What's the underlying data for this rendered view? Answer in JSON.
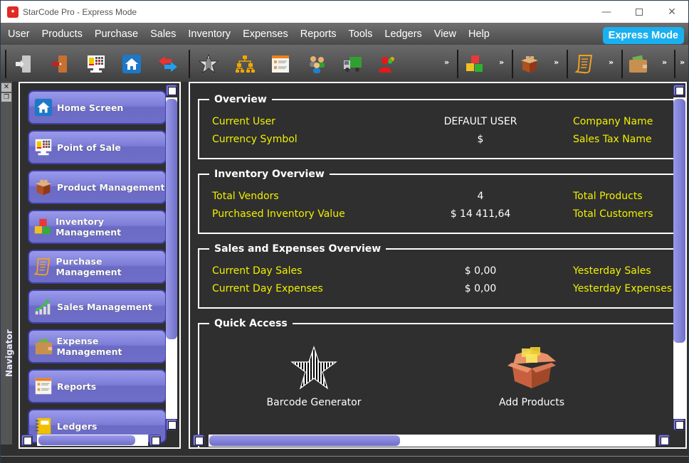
{
  "window": {
    "title": "StarCode Pro - Express Mode",
    "app_icon": "starcode-logo-icon",
    "controls": [
      "minimize",
      "maximize",
      "close"
    ]
  },
  "menubar": {
    "items": [
      "User",
      "Products",
      "Purchase",
      "Sales",
      "Inventory",
      "Expenses",
      "Reports",
      "Tools",
      "Ledgers",
      "View",
      "Help"
    ],
    "mode_badge": "Express Mode",
    "mode_badge_color": "#1ab0f0"
  },
  "toolbar": {
    "groups": [
      [
        "login-icon",
        "logout-icon",
        "point-of-sale-icon",
        "home-icon",
        "switch-icon"
      ],
      [
        "barcode-star-icon",
        "hierarchy-icon",
        "report-form-icon",
        "users-icon",
        "delivery-truck-icon",
        "customer-group-icon"
      ],
      [
        "inventory-boxes-icon"
      ],
      [
        "product-box-icon"
      ],
      [
        "purchase-list-icon"
      ],
      [
        "wallet-icon"
      ]
    ],
    "overflow_glyph": "»"
  },
  "navigator": {
    "title": "Navigator",
    "items": [
      {
        "label": "Home Screen",
        "icon": "home-icon"
      },
      {
        "label": "Point of Sale",
        "icon": "point-of-sale-icon"
      },
      {
        "label": "Product Management",
        "icon": "product-box-icon"
      },
      {
        "label": "Inventory Management",
        "icon": "inventory-boxes-icon"
      },
      {
        "label": "Purchase Management",
        "icon": "purchase-list-icon"
      },
      {
        "label": "Sales Management",
        "icon": "sales-chart-icon"
      },
      {
        "label": "Expense Management",
        "icon": "wallet-icon"
      },
      {
        "label": "Reports",
        "icon": "report-form-icon"
      },
      {
        "label": "Ledgers",
        "icon": "ledger-notebook-icon"
      }
    ]
  },
  "overview": {
    "title": "Overview",
    "current_user_label": "Current User",
    "current_user_value": "DEFAULT USER",
    "company_name_label": "Company Name",
    "currency_symbol_label": "Currency Symbol",
    "currency_symbol_value": "$",
    "sales_tax_label": "Sales Tax Name"
  },
  "inventory_overview": {
    "title": "Inventory Overview",
    "total_vendors_label": "Total Vendors",
    "total_vendors_value": "4",
    "total_products_label": "Total Products",
    "purchased_value_label": "Purchased Inventory Value",
    "purchased_value_value": "$ 14 411,64",
    "total_customers_label": "Total Customers"
  },
  "sales_expenses_overview": {
    "title": "Sales and Expenses Overview",
    "current_day_sales_label": "Current Day Sales",
    "current_day_sales_value": "$ 0,00",
    "yesterday_sales_label": "Yesterday Sales",
    "current_day_expenses_label": "Current Day Expenses",
    "current_day_expenses_value": "$ 0,00",
    "yesterday_expenses_label": "Yesterday Expenses"
  },
  "quick_access": {
    "title": "Quick Access",
    "items": [
      {
        "label": "Barcode Generator",
        "icon": "barcode-star-icon"
      },
      {
        "label": "Add Products",
        "icon": "add-products-box-icon"
      }
    ]
  },
  "colors": {
    "label_yellow": "#f0f000",
    "value_white": "#ffffff",
    "nav_button": "#7d7dd8",
    "panel_bg": "#2f2f2f"
  }
}
